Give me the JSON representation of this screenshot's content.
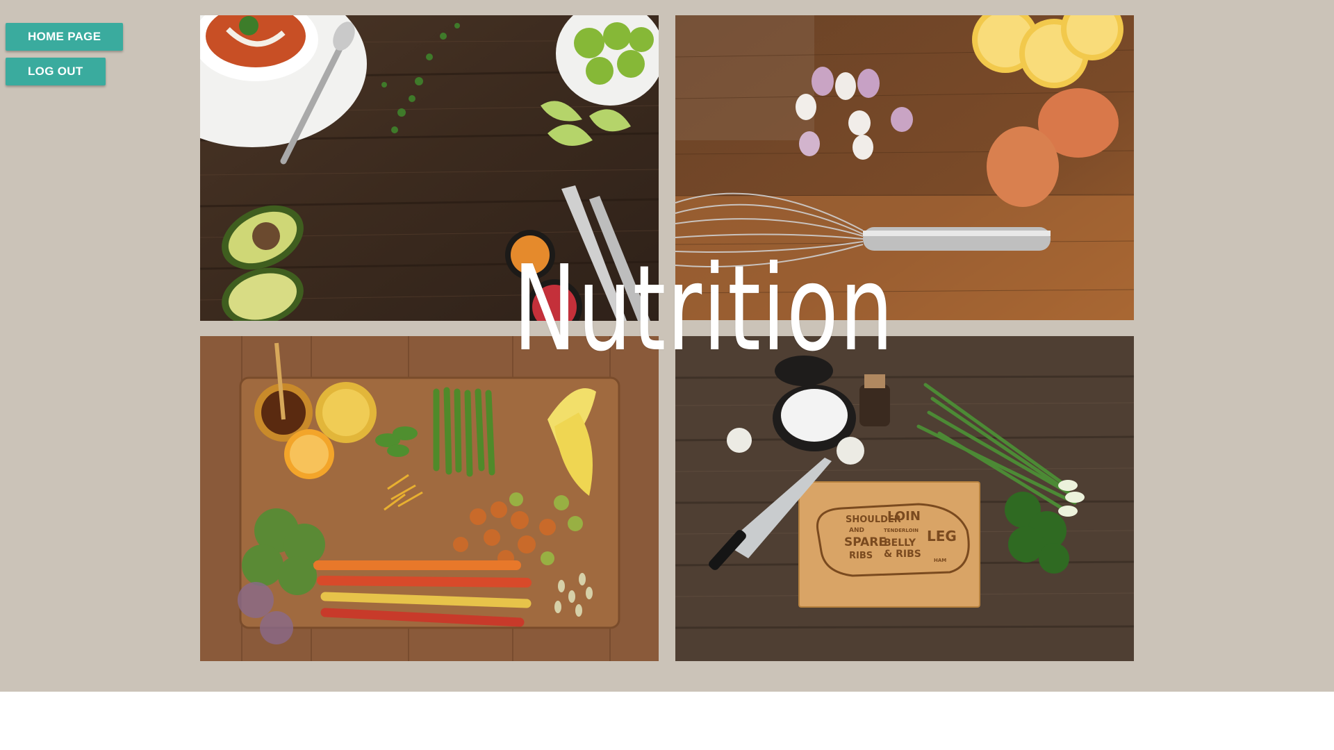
{
  "nav": {
    "home_label": "HOME PAGE",
    "logout_label": "LOG OUT"
  },
  "hero": {
    "title": "Nutrition"
  },
  "board": {
    "cut_labels": [
      "SHOULDER",
      "AND",
      "SPARE",
      "RIBS",
      "LOIN",
      "TENDERLOIN",
      "BELLY",
      "& RIBS",
      "LEG",
      "HAM"
    ]
  },
  "colors": {
    "background": "#cbc3b8",
    "button": "#3aab9e",
    "button_text": "#ffffff",
    "title": "#ffffff"
  },
  "images": [
    {
      "name": "food-photo-soup-limes-avocado"
    },
    {
      "name": "food-photo-eggs-whisk-lemon"
    },
    {
      "name": "food-photo-vegetables-board"
    },
    {
      "name": "food-photo-pork-cutting-board"
    }
  ]
}
